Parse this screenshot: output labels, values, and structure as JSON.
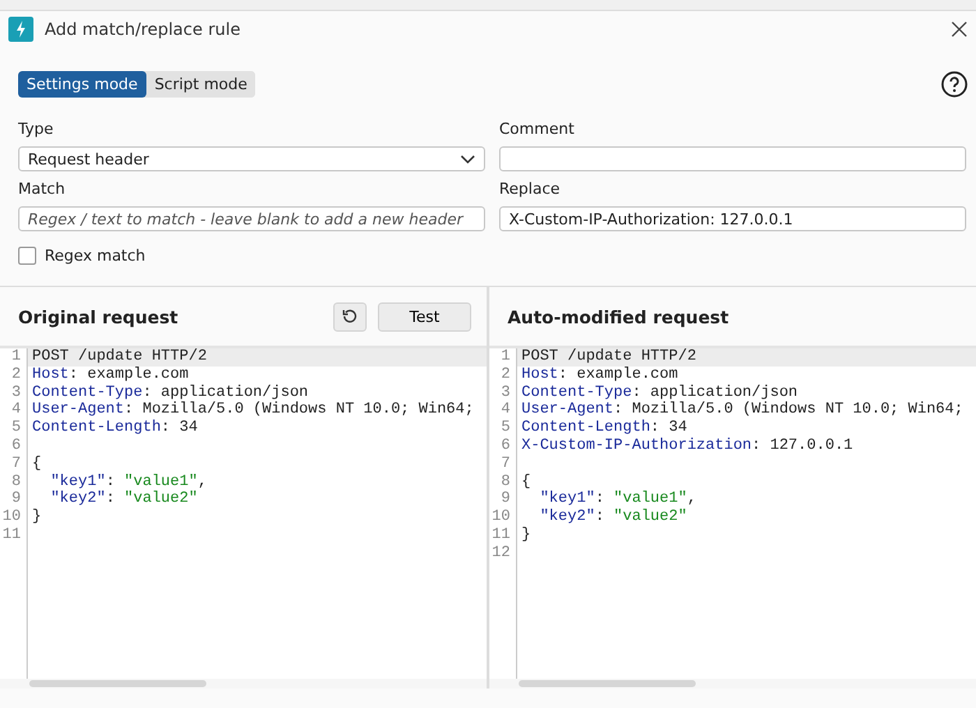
{
  "window": {
    "title": "Add match/replace rule"
  },
  "modes": [
    {
      "label": "Settings mode",
      "selected": true
    },
    {
      "label": "Script mode",
      "selected": false
    }
  ],
  "form": {
    "type": {
      "label": "Type",
      "value": "Request header"
    },
    "comment": {
      "label": "Comment"
    },
    "match": {
      "label": "Match",
      "placeholder": "Regex / text to match - leave blank to add a new header"
    },
    "replace": {
      "label": "Replace",
      "value": "X-Custom-IP-Authorization: 127.0.0.1"
    },
    "regex": {
      "label": "Regex match",
      "checked": false
    }
  },
  "panels": [
    {
      "title": "Original request",
      "test_button": "Test",
      "lines": [
        {
          "number": "1",
          "highlighted": true,
          "parts": [
            {
              "kind": "plain",
              "text": "POST /update HTTP/2"
            }
          ]
        },
        {
          "number": "2",
          "highlighted": false,
          "parts": [
            {
              "kind": "name",
              "text": "Host"
            },
            {
              "kind": "plain",
              "text": ": example.com"
            }
          ]
        },
        {
          "number": "3",
          "highlighted": false,
          "parts": [
            {
              "kind": "name",
              "text": "Content-Type"
            },
            {
              "kind": "plain",
              "text": ": application/json"
            }
          ]
        },
        {
          "number": "4",
          "highlighted": false,
          "parts": [
            {
              "kind": "name",
              "text": "User-Agent"
            },
            {
              "kind": "plain",
              "text": ": Mozilla/5.0 (Windows NT 10.0; Win64;"
            }
          ]
        },
        {
          "number": "5",
          "highlighted": false,
          "parts": [
            {
              "kind": "name",
              "text": "Content-Length"
            },
            {
              "kind": "plain",
              "text": ": 34"
            }
          ]
        },
        {
          "number": "6",
          "highlighted": false
        },
        {
          "number": "7",
          "highlighted": false,
          "parts": [
            {
              "kind": "plain",
              "text": "{"
            }
          ]
        },
        {
          "number": "8",
          "highlighted": false,
          "parts": [
            {
              "kind": "name",
              "text": "  \"key1\""
            },
            {
              "kind": "plain",
              "text": ": "
            },
            {
              "kind": "string",
              "text": "\"value1\""
            },
            {
              "kind": "plain",
              "text": ","
            }
          ]
        },
        {
          "number": "9",
          "highlighted": false,
          "parts": [
            {
              "kind": "name",
              "text": "  \"key2\""
            },
            {
              "kind": "plain",
              "text": ": "
            },
            {
              "kind": "string",
              "text": "\"value2\""
            }
          ]
        },
        {
          "number": "10",
          "highlighted": false,
          "parts": [
            {
              "kind": "plain",
              "text": "}"
            }
          ]
        },
        {
          "number": "11",
          "highlighted": false
        }
      ]
    },
    {
      "title": "Auto-modified request",
      "lines": [
        {
          "number": "1",
          "highlighted": true,
          "parts": [
            {
              "kind": "plain",
              "text": "POST /update HTTP/2"
            }
          ]
        },
        {
          "number": "2",
          "highlighted": false,
          "parts": [
            {
              "kind": "name",
              "text": "Host"
            },
            {
              "kind": "plain",
              "text": ": example.com"
            }
          ]
        },
        {
          "number": "3",
          "highlighted": false,
          "parts": [
            {
              "kind": "name",
              "text": "Content-Type"
            },
            {
              "kind": "plain",
              "text": ": application/json"
            }
          ]
        },
        {
          "number": "4",
          "highlighted": false,
          "parts": [
            {
              "kind": "name",
              "text": "User-Agent"
            },
            {
              "kind": "plain",
              "text": ": Mozilla/5.0 (Windows NT 10.0; Win64;"
            }
          ]
        },
        {
          "number": "5",
          "highlighted": false,
          "parts": [
            {
              "kind": "name",
              "text": "Content-Length"
            },
            {
              "kind": "plain",
              "text": ": 34"
            }
          ]
        },
        {
          "number": "6",
          "highlighted": false,
          "parts": [
            {
              "kind": "name",
              "text": "X-Custom-IP-Authorization"
            },
            {
              "kind": "plain",
              "text": ": 127.0.0.1"
            }
          ]
        },
        {
          "number": "7",
          "highlighted": false
        },
        {
          "number": "8",
          "highlighted": false,
          "parts": [
            {
              "kind": "plain",
              "text": "{"
            }
          ]
        },
        {
          "number": "9",
          "highlighted": false,
          "parts": [
            {
              "kind": "name",
              "text": "  \"key1\""
            },
            {
              "kind": "plain",
              "text": ": "
            },
            {
              "kind": "string",
              "text": "\"value1\""
            },
            {
              "kind": "plain",
              "text": ","
            }
          ]
        },
        {
          "number": "10",
          "highlighted": false,
          "parts": [
            {
              "kind": "name",
              "text": "  \"key2\""
            },
            {
              "kind": "plain",
              "text": ": "
            },
            {
              "kind": "string",
              "text": "\"value2\""
            }
          ]
        },
        {
          "number": "11",
          "highlighted": false,
          "parts": [
            {
              "kind": "plain",
              "text": "}"
            }
          ]
        },
        {
          "number": "12",
          "highlighted": false
        }
      ]
    }
  ]
}
